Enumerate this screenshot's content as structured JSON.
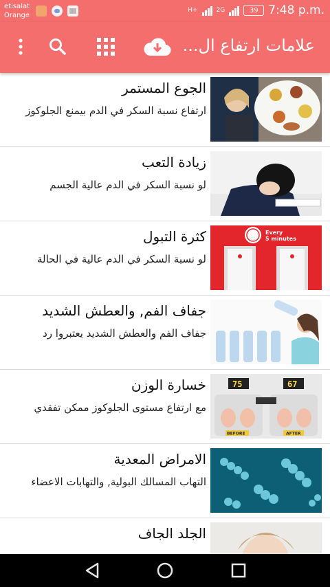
{
  "status": {
    "carrier_line1": "etisalat",
    "carrier_line2": "Orange",
    "network1": "H+",
    "network2": "2G",
    "battery": "39",
    "time": "7:48 p.m."
  },
  "appbar": {
    "title": "علامات ارتفاع ال...",
    "accent": "#f46e6e"
  },
  "items": [
    {
      "title": "الجوع المستمر",
      "desc": "ارتفاع نسبة السكر في الدم بيمنع الجلوكوز"
    },
    {
      "title": "زيادة التعب",
      "desc": "لو نسبة السكر في الدم عالية الجسم"
    },
    {
      "title": "كثرة التبول",
      "desc": "لو نسبة السكر في الدم عالية في الحالة",
      "thumb_text1": "Every",
      "thumb_text2": "5 minutes"
    },
    {
      "title": "جفاف الفم, والعطش الشديد",
      "desc": "جفاف الفم والعطش الشديد يعتبروا رد"
    },
    {
      "title": "خسارة الوزن",
      "desc": "مع ارتفاع مستوى الجلوكوز ممكن تفقدي",
      "thumb_before": "75",
      "thumb_after": "67",
      "before_label": "BEFORE",
      "after_label": "AFTER"
    },
    {
      "title": "الامراض المعدية",
      "desc": "التهاب المسالك البولية, والتهابات الاعضاء"
    },
    {
      "title": "الجلد الجاف",
      "desc": ""
    }
  ]
}
